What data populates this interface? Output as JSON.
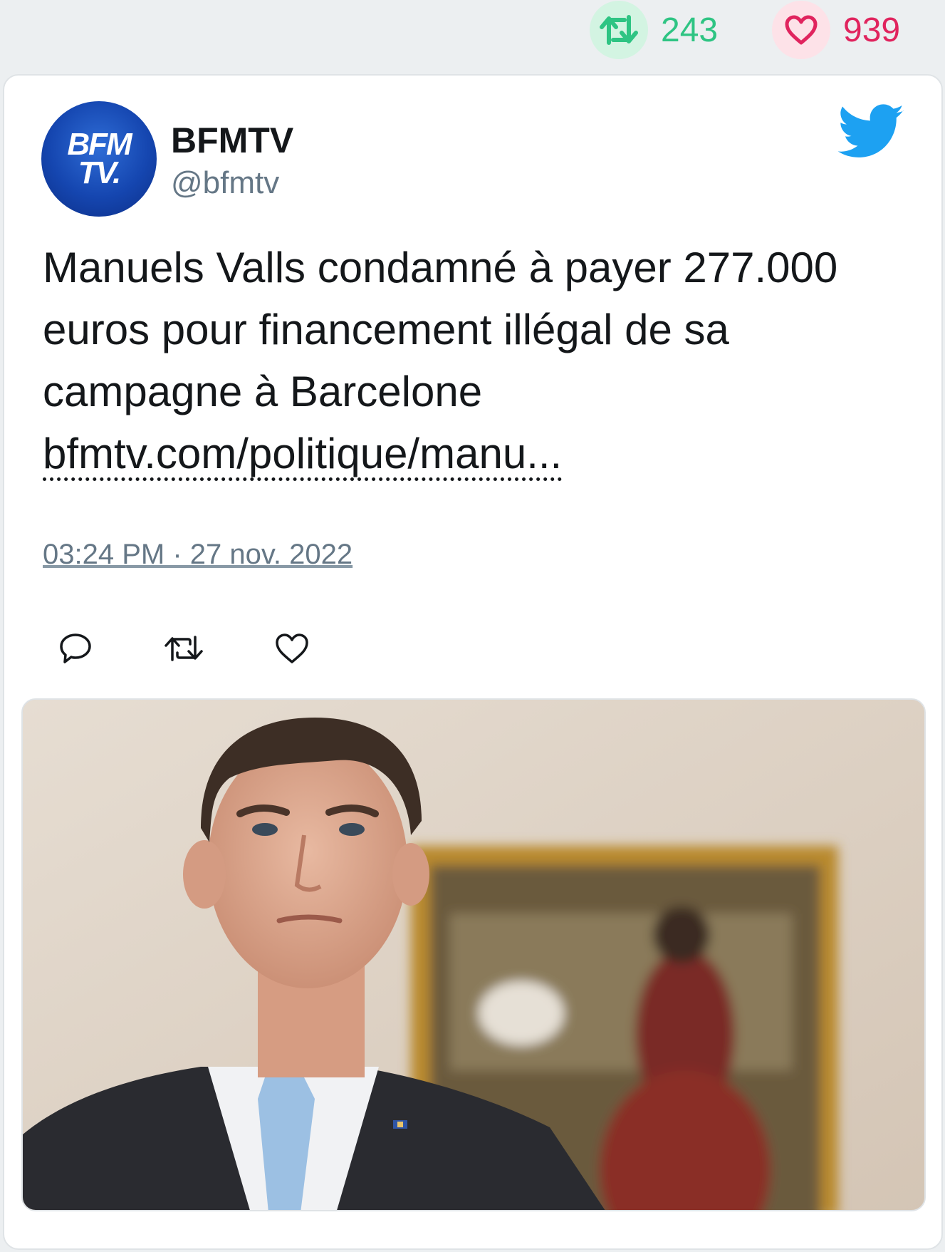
{
  "engagement": {
    "retweet_icon": "retweet-icon",
    "retweets": "243",
    "like_icon": "heart-icon",
    "likes": "939"
  },
  "author": {
    "name": "BFMTV",
    "handle": "@bfmtv",
    "avatar_logo_line1": "BFM",
    "avatar_logo_line2": "TV."
  },
  "tweet": {
    "text": "Manuels Valls condamné à payer 277.000 euros pour financement illégal de sa campagne à Barcelone",
    "link": "bfmtv.com/politique/manu...",
    "timestamp": "03:24 PM · 27 nov. 2022"
  },
  "actions": [
    "reply-icon",
    "retweet-icon",
    "heart-icon"
  ],
  "colors": {
    "retweet": "#2ec483",
    "like": "#e0245e",
    "twitter_blue": "#1da1f2",
    "muted": "#657786"
  }
}
